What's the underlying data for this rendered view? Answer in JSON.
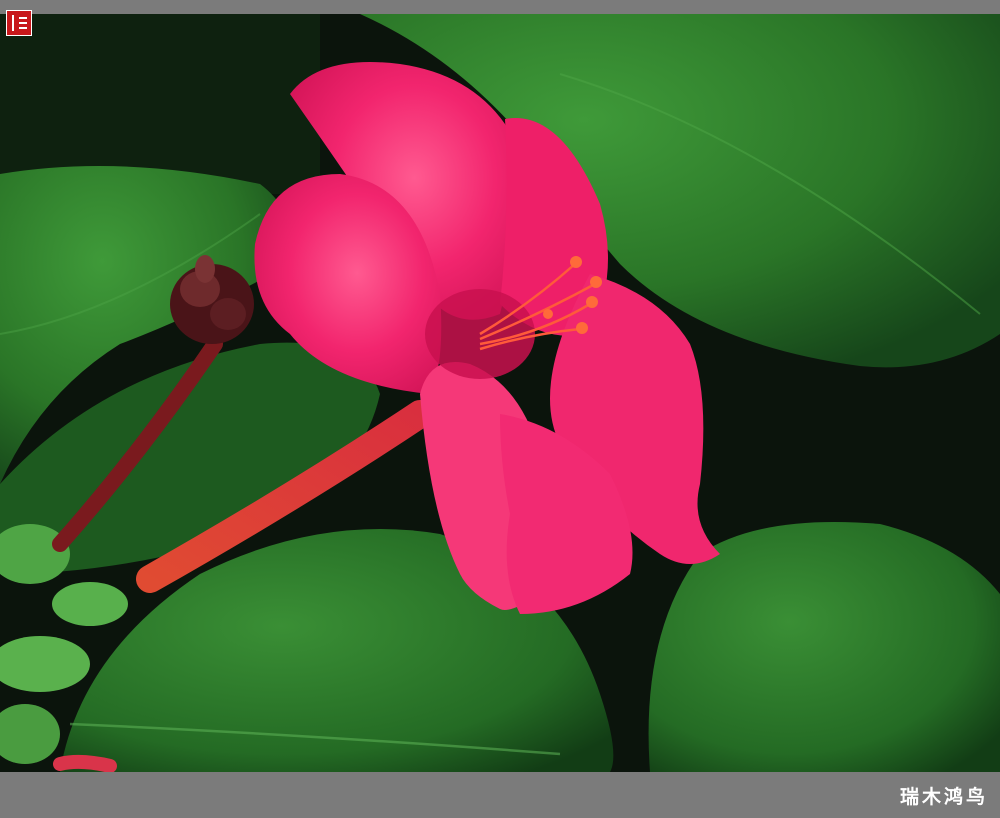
{
  "image": {
    "subject": "flower",
    "colors": {
      "frame": "#7b7b7b",
      "background": "#0b140c",
      "leaf": "#2f7d2c",
      "petal": "#f2256e",
      "stem": "#e14a3c"
    }
  },
  "caption": {
    "text": "瑞木鸿鸟"
  },
  "seal": {
    "icon": "red-seal-stamp"
  }
}
